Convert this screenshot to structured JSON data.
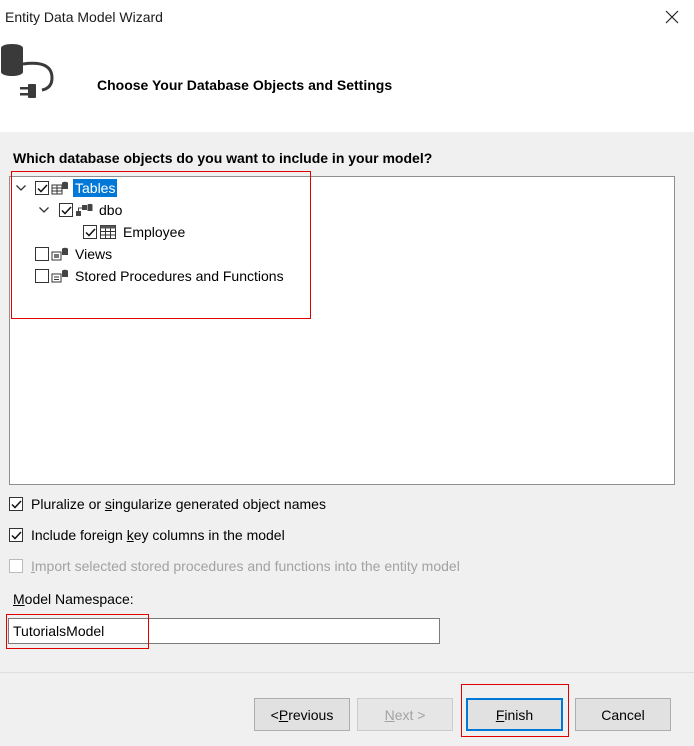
{
  "window": {
    "title": "Entity Data Model Wizard"
  },
  "header": {
    "title": "Choose Your Database Objects and Settings",
    "icon": "database-plug-icon"
  },
  "objects": {
    "question": "Which database objects do you want to include in your model?",
    "tree": [
      {
        "label": "Tables",
        "checked": true,
        "expanded": true,
        "selected": true,
        "icon": "tables-icon"
      },
      {
        "label": "dbo",
        "checked": true,
        "expanded": true,
        "icon": "schema-icon"
      },
      {
        "label": "Employee",
        "checked": true,
        "icon": "table-grid-icon"
      },
      {
        "label": "Views",
        "checked": false,
        "icon": "views-icon"
      },
      {
        "label": "Stored Procedures and Functions",
        "checked": false,
        "icon": "stored-procedures-icon"
      }
    ]
  },
  "options": {
    "pluralize": {
      "pre": "Pluralize or ",
      "u": "s",
      "post": "ingularize generated object names",
      "checked": true,
      "enabled": true
    },
    "foreign_keys": {
      "pre": "Include foreign ",
      "u": "k",
      "post": "ey columns in the model",
      "checked": true,
      "enabled": true
    },
    "import_sprocs": {
      "pre": "",
      "u": "I",
      "post": "mport selected stored procedures and functions into the entity model",
      "checked": false,
      "enabled": false
    }
  },
  "namespace": {
    "label_u": "M",
    "label_rest": "odel Namespace:",
    "value": "TutorialsModel"
  },
  "buttons": {
    "previous": {
      "pre": "< ",
      "u": "P",
      "post": "revious",
      "enabled": true
    },
    "next": {
      "pre": "",
      "u": "N",
      "post": "ext >",
      "enabled": false
    },
    "finish": {
      "pre": "",
      "u": "F",
      "post": "inish",
      "enabled": true,
      "default": true
    },
    "cancel": {
      "label": "Cancel",
      "enabled": true
    }
  },
  "colors": {
    "highlight_red": "#e00000",
    "selection_blue": "#0078d7",
    "focus_blue": "#0078d7"
  }
}
